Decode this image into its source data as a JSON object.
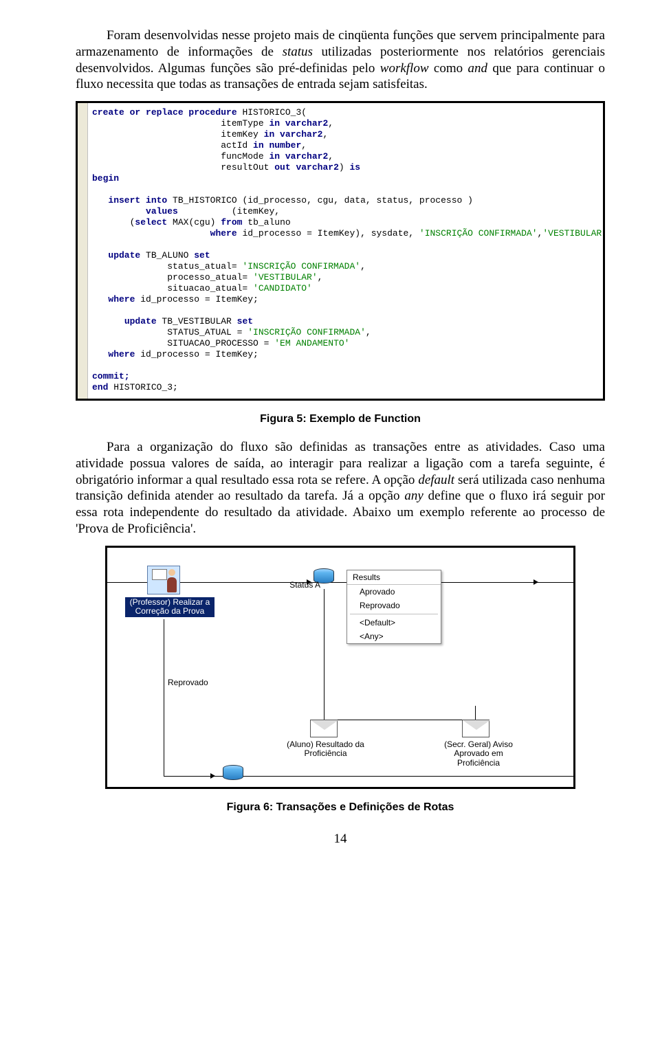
{
  "paragraph1_parts": {
    "a": "Foram desenvolvidas nesse projeto mais de cinqüenta funções que servem principalmente para armazenamento de informações de ",
    "b": "status",
    "c": " utilizadas posteriormente nos relatórios gerenciais desenvolvidos. Algumas funções são pré-definidas pelo ",
    "d": "workflow",
    "e": " como ",
    "f": "and",
    "g": " que para continuar o fluxo necessita que todas as transações de entrada sejam satisfeitas."
  },
  "code": {
    "l01a": "create or replace procedure",
    "l01b": " HISTORICO_3(",
    "l02a": "                        itemType ",
    "l02b": "in varchar2",
    "l02c": ",",
    "l03a": "                        itemKey ",
    "l03b": "in varchar2",
    "l03c": ",",
    "l04a": "                        actId ",
    "l04b": "in number",
    "l04c": ",",
    "l05a": "                        funcMode ",
    "l05b": "in varchar2",
    "l05c": ",",
    "l06a": "                        resultOut ",
    "l06b": "out varchar2",
    "l06c": ") ",
    "l06d": "is",
    "l07": "begin",
    "l08": "",
    "l09a": "   ",
    "l09b": "insert into",
    "l09c": " TB_HISTORICO (id_processo, cgu, data, status, processo )",
    "l10a": "          ",
    "l10b": "values",
    "l10c": "          (itemKey,",
    "l11a": "       (",
    "l11b": "select",
    "l11c": " MAX(cgu) ",
    "l11d": "from",
    "l11e": " tb_aluno",
    "l12a": "                      ",
    "l12b": "where",
    "l12c": " id_processo = ItemKey), sysdate, ",
    "l12d": "'INSCRIÇÃO CONFIRMADA'",
    "l12e": ",",
    "l12f": "'VESTIBULAR'",
    "l12g": ");",
    "l13": "",
    "l14a": "   ",
    "l14b": "update",
    "l14c": " TB_ALUNO ",
    "l14d": "set",
    "l15a": "              status_atual= ",
    "l15b": "'INSCRIÇÃO CONFIRMADA'",
    "l15c": ",",
    "l16a": "              processo_atual= ",
    "l16b": "'VESTIBULAR'",
    "l16c": ",",
    "l17a": "              situacao_atual= ",
    "l17b": "'CANDIDATO'",
    "l18a": "   ",
    "l18b": "where",
    "l18c": " id_processo = ItemKey;",
    "l19": "",
    "l20a": "      ",
    "l20b": "update",
    "l20c": " TB_VESTIBULAR ",
    "l20d": "set",
    "l21a": "              STATUS_ATUAL = ",
    "l21b": "'INSCRIÇÃO CONFIRMADA'",
    "l21c": ",",
    "l22a": "              SITUACAO_PROCESSO = ",
    "l22b": "'EM ANDAMENTO'",
    "l23a": "   ",
    "l23b": "where",
    "l23c": " id_processo = ItemKey;",
    "l24": "",
    "l25": "commit;",
    "l26a": "end",
    "l26b": " HISTORICO_3;"
  },
  "caption1": "Figura 5: Exemplo de Function",
  "paragraph2_parts": {
    "a": "Para a organização do fluxo são definidas as transações entre as atividades. Caso uma atividade possua valores de saída, ao interagir para realizar a ligação com a tarefa seguinte, é obrigatório informar a qual resultado essa rota se refere. A opção ",
    "b": "default",
    "c": " será utilizada caso nenhuma transição definida atender ao resultado da tarefa. Já a opção ",
    "d": "any",
    "e": " define que o fluxo irá seguir por essa rota independente do resultado da atividade. Abaixo um exemplo referente ao processo de 'Prova de Proficiência'."
  },
  "flow": {
    "sel_label_l1": "(Professor) Realizar a",
    "sel_label_l2": "Correção da Prova",
    "status_label": "Status A",
    "reprovado": "Reprovado",
    "aluno_l1": "(Aluno) Resultado da",
    "aluno_l2": "Proficiência",
    "secr_l1": "(Secr. Geral) Aviso",
    "secr_l2": "Aprovado em",
    "secr_l3": "Proficiência",
    "menu_header": "Results",
    "menu_item1": "Aprovado",
    "menu_item2": "Reprovado",
    "menu_item3": "<Default>",
    "menu_item4": "<Any>"
  },
  "caption2": "Figura 6: Transações e Definições de Rotas",
  "page_number": "14"
}
